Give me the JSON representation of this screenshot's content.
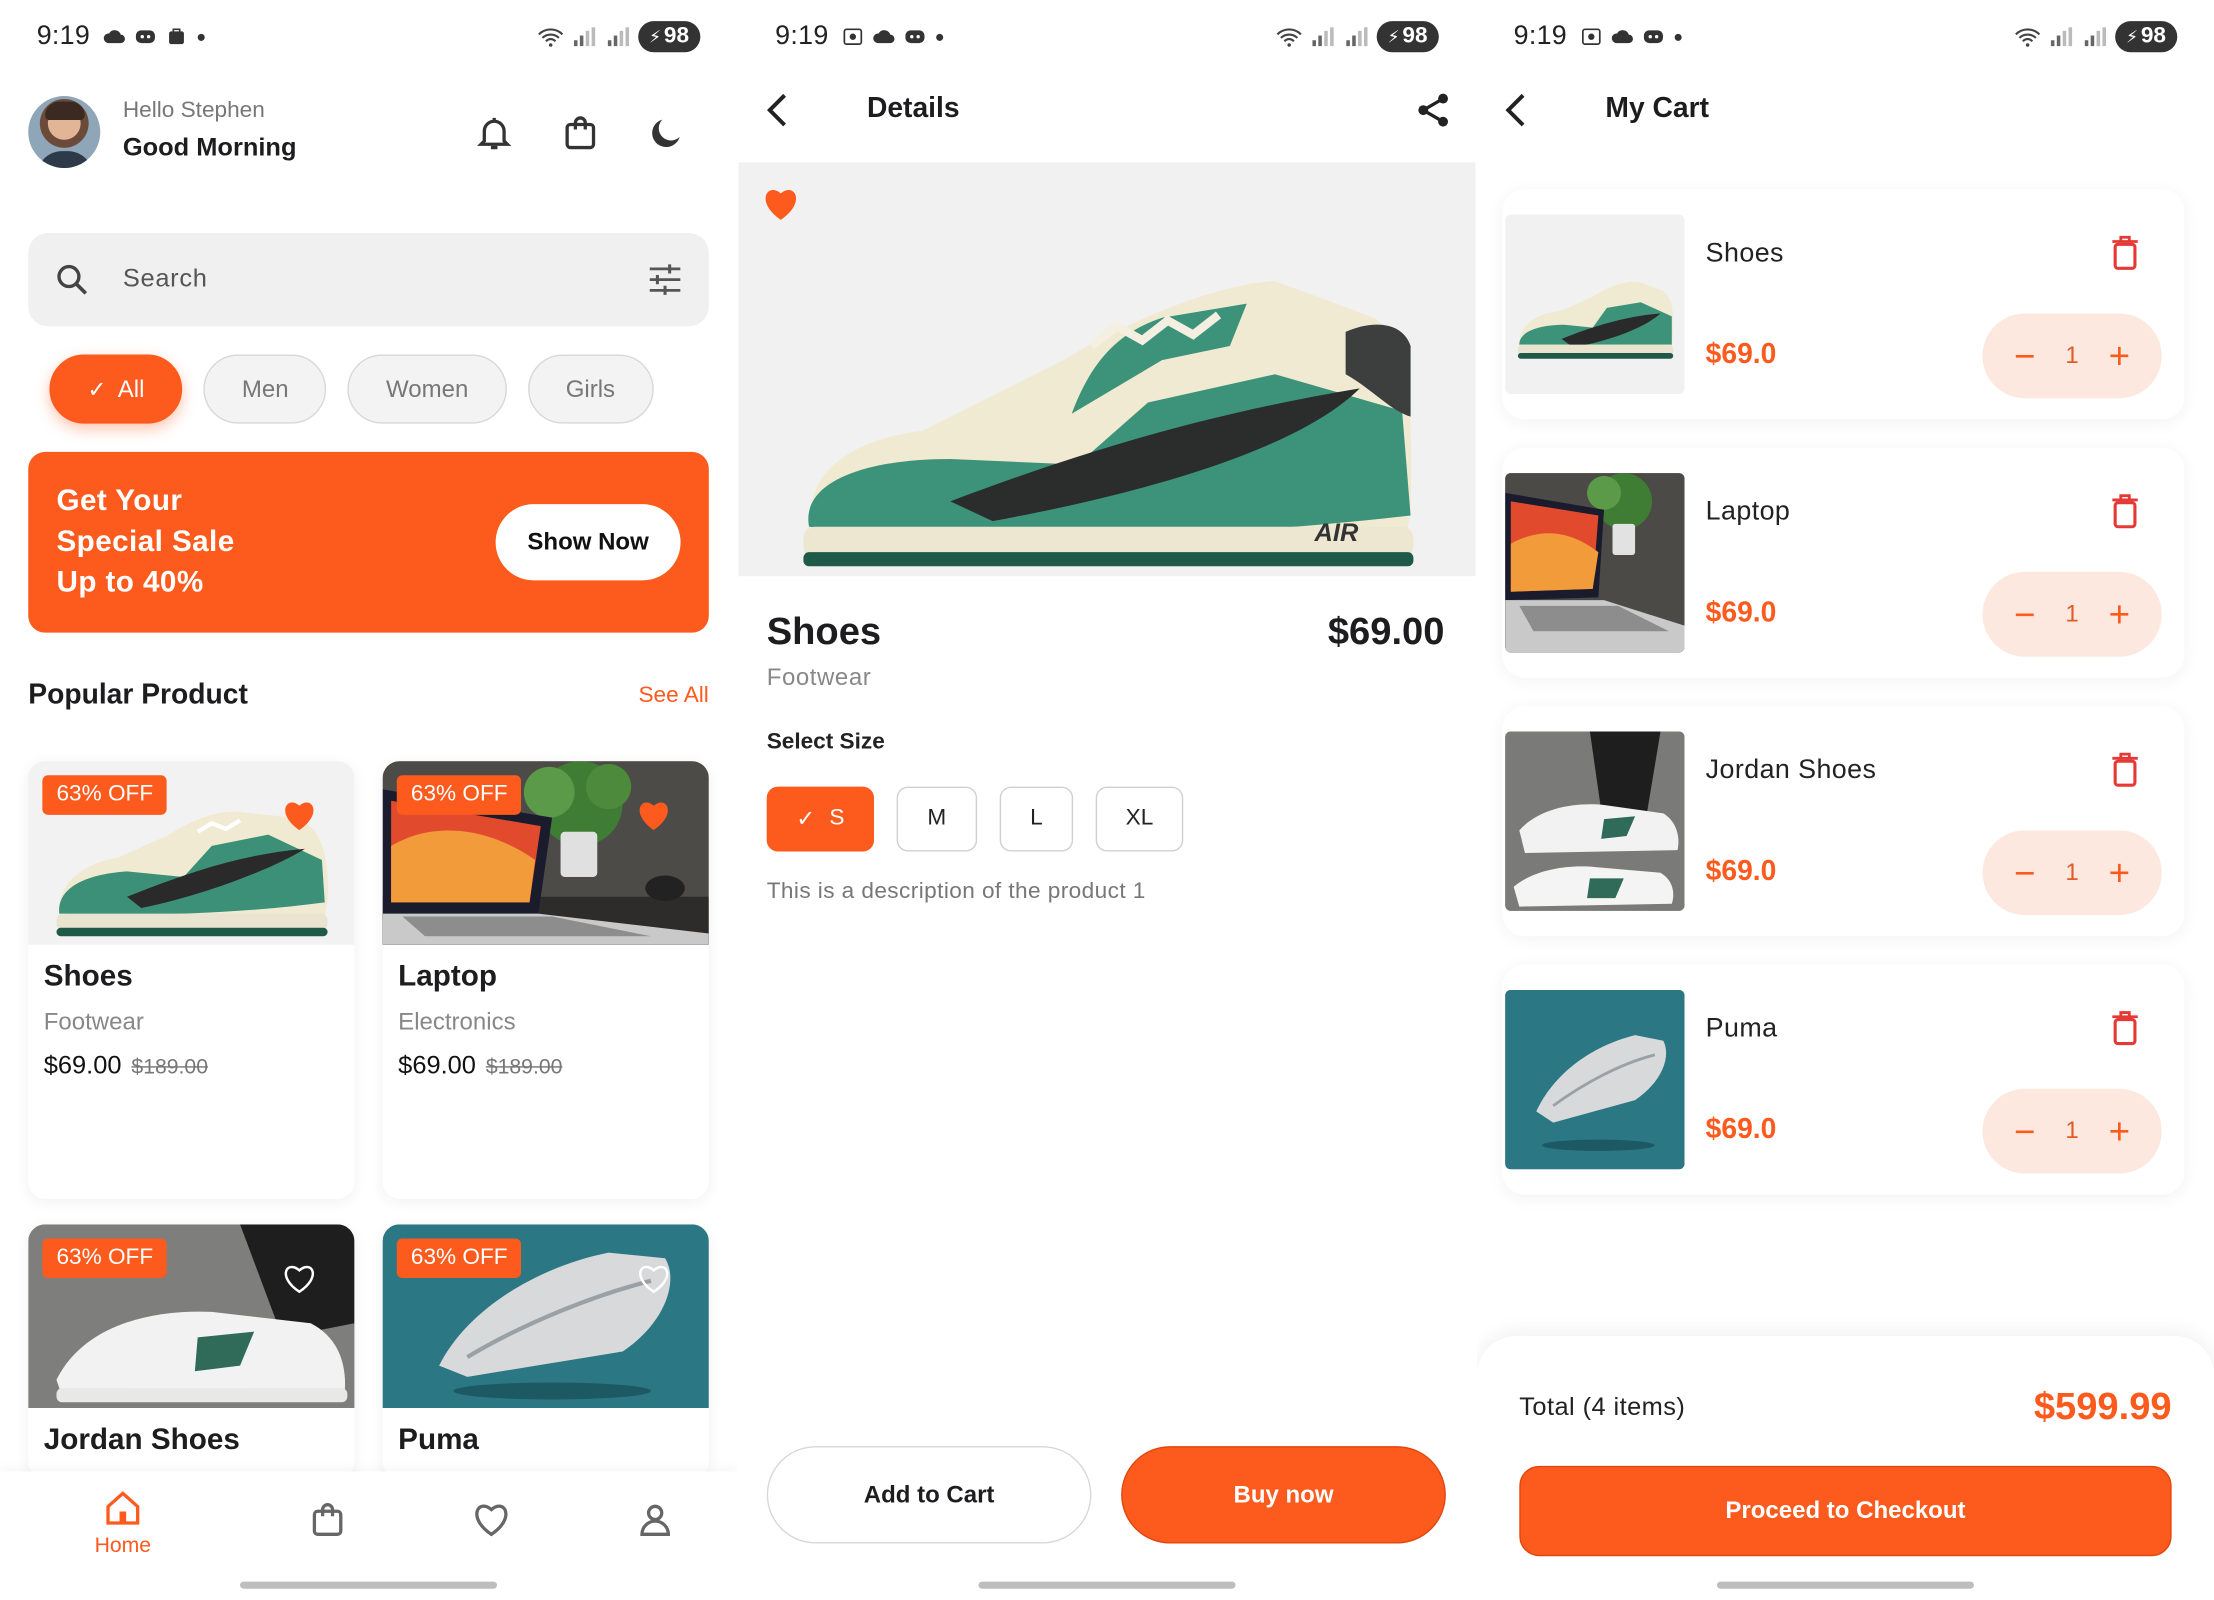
{
  "status": {
    "time": "9:19",
    "battery": "98"
  },
  "home": {
    "hello": "Hello Stephen",
    "greeting": "Good Morning",
    "search_placeholder": "Search",
    "chips": [
      "All",
      "Men",
      "Women",
      "Girls"
    ],
    "active_chip": "All",
    "banner_text": "Get Your\nSpecial Sale\nUp to 40%",
    "banner_button": "Show Now",
    "section_title": "Popular Product",
    "see_all": "See All",
    "products": [
      {
        "name": "Shoes",
        "category": "Footwear",
        "price": "$69.00",
        "old_price": "$189.00",
        "discount": "63% OFF",
        "favorite": true
      },
      {
        "name": "Laptop",
        "category": "Electronics",
        "price": "$69.00",
        "old_price": "$189.00",
        "discount": "63% OFF",
        "favorite": true
      },
      {
        "name": "Jordan Shoes",
        "discount": "63% OFF",
        "favorite": false
      },
      {
        "name": "Puma",
        "discount": "63% OFF",
        "favorite": false
      }
    ],
    "nav": [
      {
        "label": "Home",
        "icon": "home-icon",
        "active": true
      },
      {
        "label": "",
        "icon": "shopping-bag-icon",
        "active": false
      },
      {
        "label": "",
        "icon": "heart-icon",
        "active": false
      },
      {
        "label": "",
        "icon": "profile-icon",
        "active": false
      }
    ]
  },
  "details": {
    "title": "Details",
    "name": "Shoes",
    "price": "$69.00",
    "category": "Footwear",
    "select_size": "Select Size",
    "sizes": [
      "S",
      "M",
      "L",
      "XL"
    ],
    "selected_size": "S",
    "description": "This is a description of the product 1",
    "add_to_cart": "Add to Cart",
    "buy_now": "Buy now"
  },
  "cart": {
    "title": "My Cart",
    "items": [
      {
        "name": "Shoes",
        "price": "$69.0",
        "qty": "1"
      },
      {
        "name": "Laptop",
        "price": "$69.0",
        "qty": "1"
      },
      {
        "name": "Jordan Shoes",
        "price": "$69.0",
        "qty": "1"
      },
      {
        "name": "Puma",
        "price": "$69.0",
        "qty": "1"
      }
    ],
    "total_label": "Total (4 items)",
    "total_value": "$599.99",
    "checkout": "Proceed to Checkout"
  },
  "colors": {
    "accent": "#fd5a1e",
    "danger": "#e53935",
    "stepper_bg": "#fde8e0"
  }
}
